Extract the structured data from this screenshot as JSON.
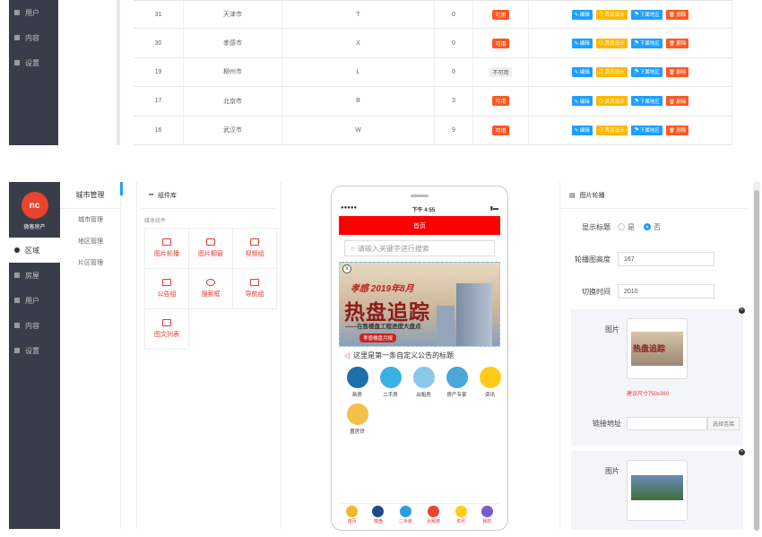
{
  "top": {
    "nav": [
      {
        "label": "用户",
        "icon": "user-icon"
      },
      {
        "label": "内容",
        "icon": "book-icon"
      },
      {
        "label": "设置",
        "icon": "gear-icon"
      }
    ],
    "rows": [
      {
        "id": "31",
        "city": "天津市",
        "letter": "T",
        "count": "0",
        "status": "可用",
        "available": true
      },
      {
        "id": "30",
        "city": "孝感市",
        "letter": "X",
        "count": "0",
        "status": "可用",
        "available": true
      },
      {
        "id": "19",
        "city": "柳州市",
        "letter": "L",
        "count": "0",
        "status": "不可用",
        "available": false
      },
      {
        "id": "17",
        "city": "北京市",
        "letter": "B",
        "count": "3",
        "status": "可用",
        "available": true
      },
      {
        "id": "16",
        "city": "武汉市",
        "letter": "W",
        "count": "9",
        "status": "可用",
        "available": true
      }
    ],
    "actions": {
      "edit": "✎ 编辑",
      "home": "⊙ 首页设计",
      "area": "☂ 下属地区",
      "delete": "🗑 删除"
    }
  },
  "bottom": {
    "brand": "微客房产",
    "logo_text": "nc",
    "nav": [
      {
        "label": "区域",
        "icon": "gear-icon",
        "active": true
      },
      {
        "label": "房屋",
        "icon": "house-icon",
        "active": false
      },
      {
        "label": "用户",
        "icon": "user-icon",
        "active": false
      },
      {
        "label": "内容",
        "icon": "book-icon",
        "active": false
      },
      {
        "label": "设置",
        "icon": "gear-icon",
        "active": false
      }
    ],
    "submenu": {
      "title": "城市管理",
      "items": [
        "城市管理",
        "地区管理",
        "片区管理"
      ]
    },
    "components": {
      "title": "组件库",
      "subtitle": "媒体组件",
      "items": [
        "图片轮播",
        "图片橱窗",
        "视频组",
        "公告组",
        "搜索框",
        "导航组",
        "图文列表"
      ]
    },
    "phone": {
      "carrier": "●●●●●",
      "time": "下午 4:55",
      "header": "首页",
      "search_placeholder": "请输入关键字进行搜索",
      "banner": {
        "line1": "孝感 2019年8月",
        "line2": "热盘追踪",
        "line3": "——在售楼盘工程进度大盘点",
        "line4": "孝感楼盘月报"
      },
      "notice": "这里是第一条自定义公告的标题",
      "icons": [
        {
          "label": "新房",
          "color": "#1c6fa8"
        },
        {
          "label": "二手房",
          "color": "#3ab0e5"
        },
        {
          "label": "出租房",
          "color": "#8ac8e8"
        },
        {
          "label": "房产专家",
          "color": "#4aa7d8"
        },
        {
          "label": "资讯",
          "color": "#ffcc1a"
        },
        {
          "label": "置房贷",
          "color": "#f3c14a"
        }
      ],
      "tabs": [
        {
          "label": "首页",
          "color": "#f5b52a"
        },
        {
          "label": "楼盘",
          "color": "#1a4e8a"
        },
        {
          "label": "二手房",
          "color": "#2e9fd8"
        },
        {
          "label": "出租房",
          "color": "#e8442e"
        },
        {
          "label": "资讯",
          "color": "#ffcc1a"
        },
        {
          "label": "我的",
          "color": "#7a5ccc"
        }
      ]
    },
    "props": {
      "title": "图片轮播",
      "show_title_label": "显示标题",
      "opt_yes": "是",
      "opt_no": "否",
      "height_label": "轮播图高度",
      "height_value": "167",
      "interval_label": "切换时间",
      "interval_value": "2010",
      "image_label": "图片",
      "size_hint": "建议尺寸750x360",
      "link_label": "链接地址",
      "choose_link": "选择连接",
      "thumb_line1": "热盘追踪"
    }
  }
}
